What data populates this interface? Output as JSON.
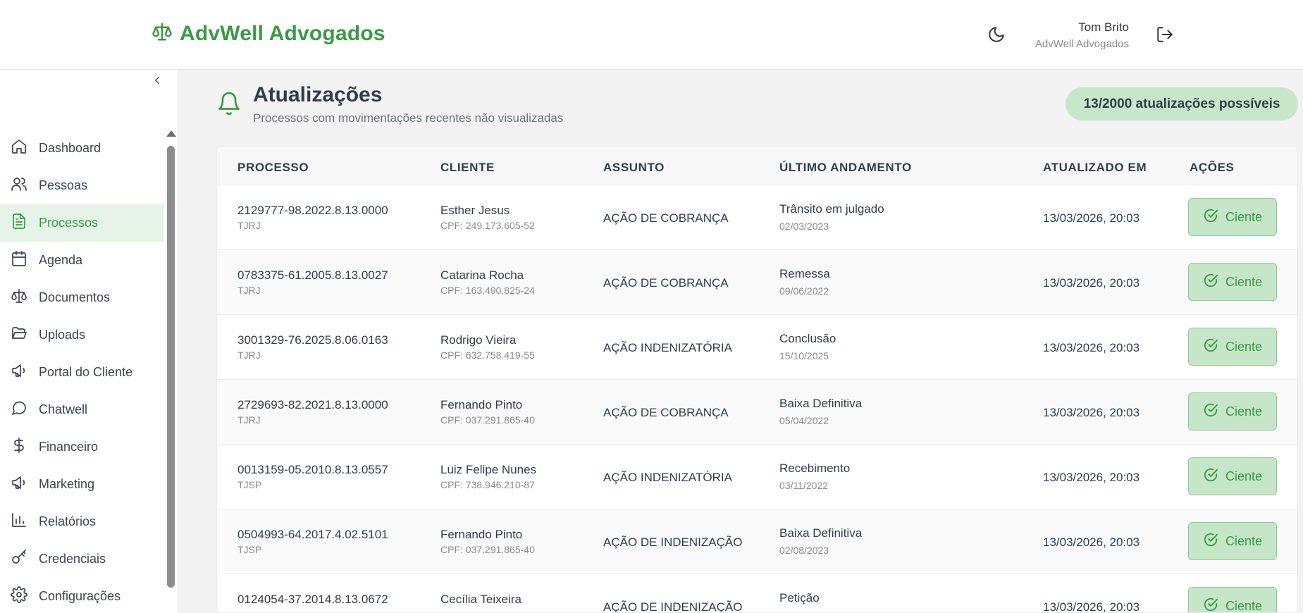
{
  "header": {
    "brand": "AdvWell Advogados",
    "user_name": "Tom Brito",
    "user_org": "AdvWell Advogados"
  },
  "sidebar": {
    "items": [
      {
        "label": "Dashboard",
        "icon": "home-icon"
      },
      {
        "label": "Pessoas",
        "icon": "users-icon"
      },
      {
        "label": "Processos",
        "icon": "file-text-icon",
        "active": true
      },
      {
        "label": "Agenda",
        "icon": "calendar-icon"
      },
      {
        "label": "Documentos",
        "icon": "scale-icon"
      },
      {
        "label": "Uploads",
        "icon": "folder-open-icon"
      },
      {
        "label": "Portal do Cliente",
        "icon": "megaphone-icon"
      },
      {
        "label": "Chatwell",
        "icon": "chat-bubble-icon"
      },
      {
        "label": "Financeiro",
        "icon": "dollar-icon"
      },
      {
        "label": "Marketing",
        "icon": "megaphone-icon"
      },
      {
        "label": "Relatórios",
        "icon": "bar-chart-icon"
      },
      {
        "label": "Credenciais",
        "icon": "key-icon"
      },
      {
        "label": "Configurações",
        "icon": "gear-icon"
      }
    ]
  },
  "page": {
    "title": "Atualizações",
    "subtitle": "Processos com movimentações recentes não visualizadas",
    "quota": "13/2000 atualizações possíveis"
  },
  "table": {
    "columns": [
      "PROCESSO",
      "CLIENTE",
      "ASSUNTO",
      "ÚLTIMO ANDAMENTO",
      "ATUALIZADO EM",
      "AÇÕES"
    ],
    "action_label": "Ciente",
    "rows": [
      {
        "process": "2129777-98.2022.8.13.0000",
        "court": "TJRJ",
        "client": "Esther Jesus",
        "cpf": "CPF: 249.173.605-52",
        "subject": "AÇÃO DE COBRANÇA",
        "last": "Trânsito em julgado",
        "last_date": "02/03/2023",
        "updated": "13/03/2026, 20:03"
      },
      {
        "process": "0783375-61.2005.8.13.0027",
        "court": "TJRJ",
        "client": "Catarina Rocha",
        "cpf": "CPF: 163.490.825-24",
        "subject": "AÇÃO DE COBRANÇA",
        "last": "Remessa",
        "last_date": "09/06/2022",
        "updated": "13/03/2026, 20:03"
      },
      {
        "process": "3001329-76.2025.8.06.0163",
        "court": "TJRJ",
        "client": "Rodrigo Vieira",
        "cpf": "CPF: 632.758.419-55",
        "subject": "AÇÃO INDENIZATÓRIA",
        "last": "Conclusão",
        "last_date": "15/10/2025",
        "updated": "13/03/2026, 20:03"
      },
      {
        "process": "2729693-82.2021.8.13.0000",
        "court": "TJRJ",
        "client": "Fernando Pinto",
        "cpf": "CPF: 037.291.865-40",
        "subject": "AÇÃO DE COBRANÇA",
        "last": "Baixa Definitiva",
        "last_date": "05/04/2022",
        "updated": "13/03/2026, 20:03"
      },
      {
        "process": "0013159-05.2010.8.13.0557",
        "court": "TJSP",
        "client": "Luiz Felipe Nunes",
        "cpf": "CPF: 738.946.210-87",
        "subject": "AÇÃO INDENIZATÓRIA",
        "last": "Recebimento",
        "last_date": "03/11/2022",
        "updated": "13/03/2026, 20:03"
      },
      {
        "process": "0504993-64.2017.4.02.5101",
        "court": "TJSP",
        "client": "Fernando Pinto",
        "cpf": "CPF: 037.291.865-40",
        "subject": "AÇÃO DE INDENIZAÇÃO",
        "last": "Baixa Definitiva",
        "last_date": "02/08/2023",
        "updated": "13/03/2026, 20:03"
      },
      {
        "process": "0124054-37.2014.8.13.0672",
        "court": "",
        "client": "Cecília Teixeira",
        "cpf": "",
        "subject": "AÇÃO DE INDENIZAÇÃO",
        "last": "Petição",
        "last_date": "",
        "updated": "13/03/2026, 20:03"
      }
    ]
  },
  "colors": {
    "brand_green": "#3a9a46",
    "active_bg": "#e6f4e8",
    "pill_bg": "#c7e7c9"
  }
}
